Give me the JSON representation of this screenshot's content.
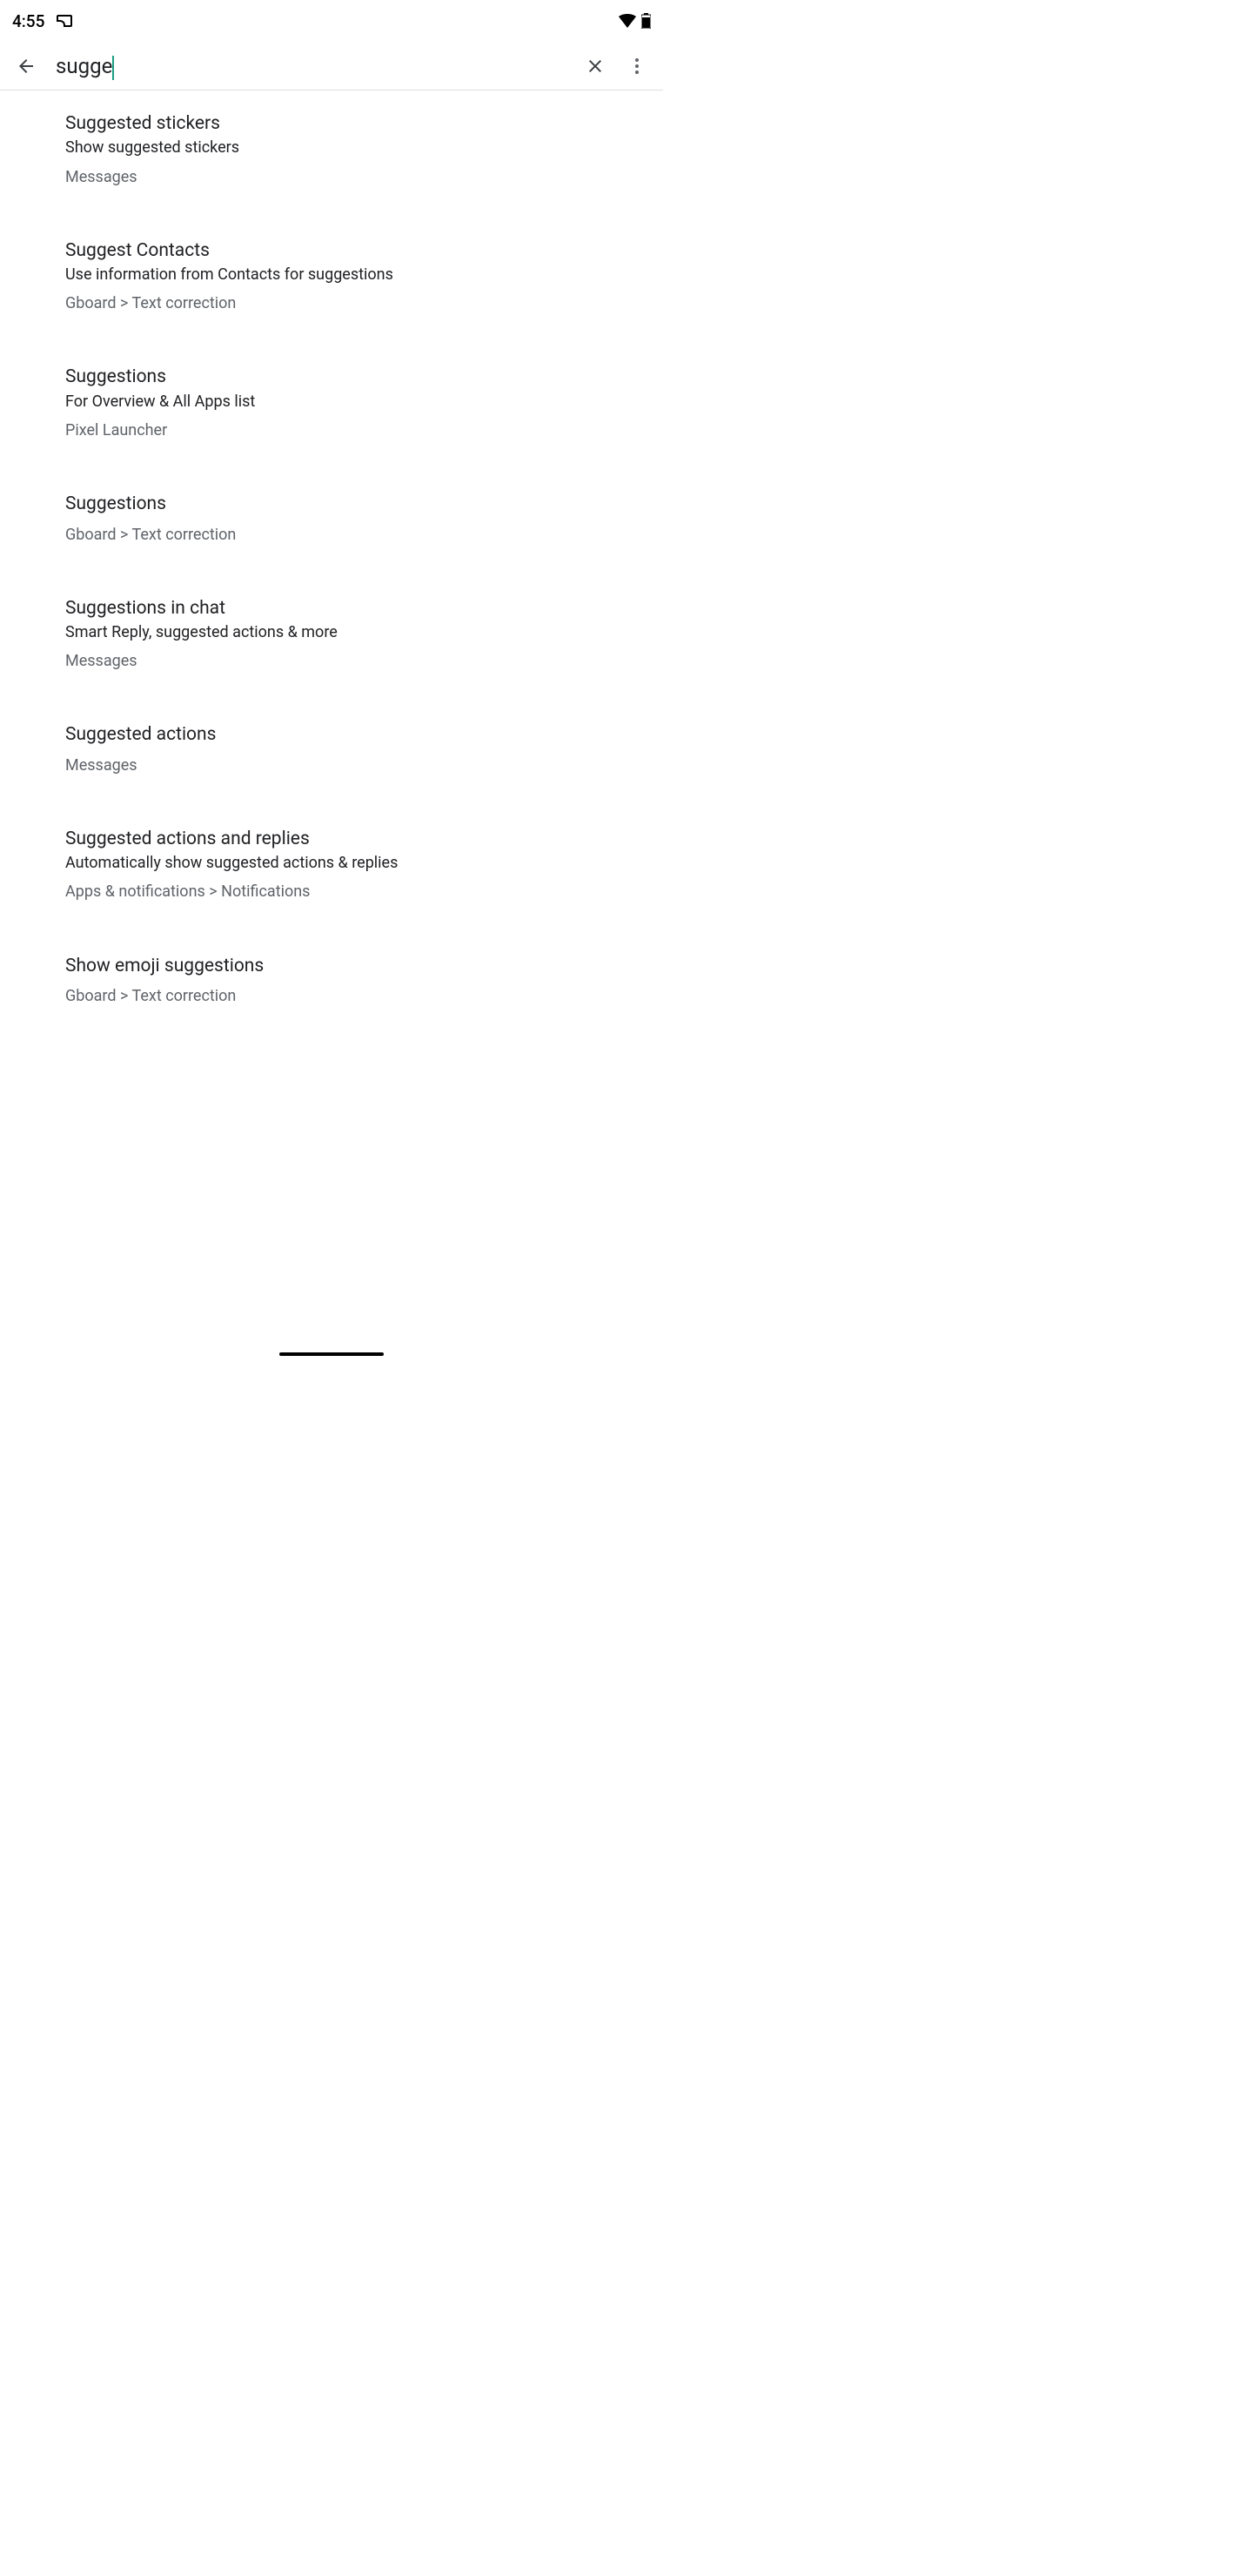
{
  "status": {
    "time": "4:55"
  },
  "search": {
    "value": "sugge"
  },
  "results": [
    {
      "title": "Suggested stickers",
      "subtitle": "Show suggested stickers",
      "path": "Messages"
    },
    {
      "title": "Suggest Contacts",
      "subtitle": "Use information from Contacts for suggestions",
      "path": "Gboard > Text correction"
    },
    {
      "title": "Suggestions",
      "subtitle": "For Overview & All Apps list",
      "path": "Pixel Launcher"
    },
    {
      "title": "Suggestions",
      "subtitle": "",
      "path": "Gboard > Text correction"
    },
    {
      "title": "Suggestions in chat",
      "subtitle": "Smart Reply, suggested actions & more",
      "path": "Messages"
    },
    {
      "title": "Suggested actions",
      "subtitle": "",
      "path": "Messages"
    },
    {
      "title": "Suggested actions and replies",
      "subtitle": "Automatically show suggested actions & replies",
      "path": "Apps & notifications > Notifications"
    },
    {
      "title": "Show emoji suggestions",
      "subtitle": "",
      "path": "Gboard > Text correction"
    }
  ]
}
